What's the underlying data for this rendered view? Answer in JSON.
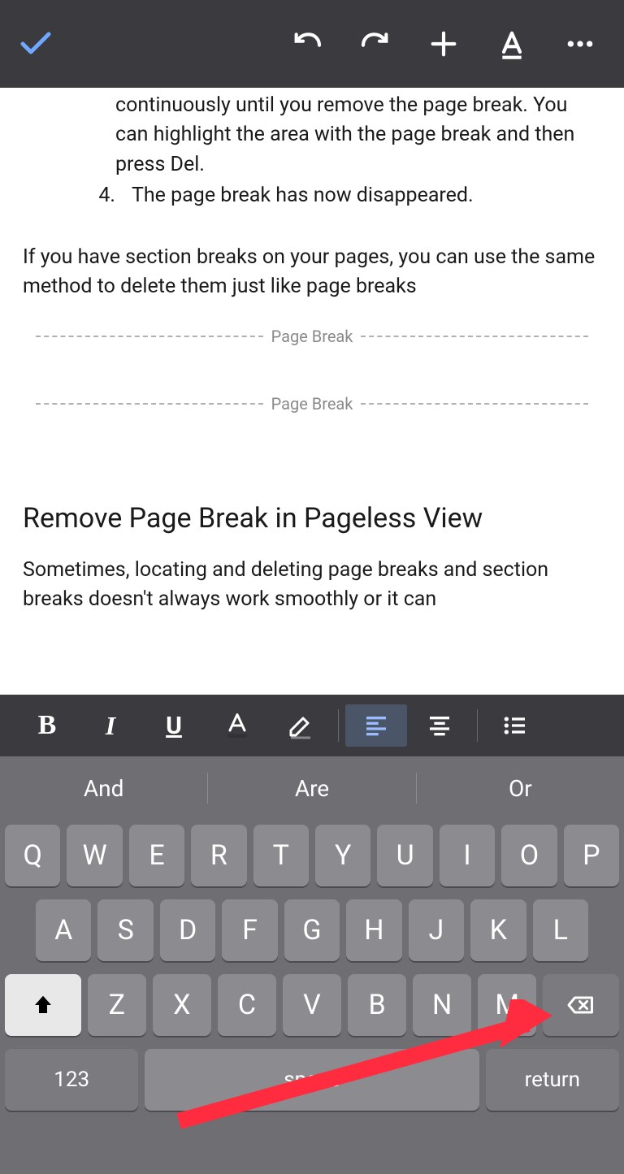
{
  "document": {
    "partial_step3": "continuously until you remove the page break. You can highlight the area with the page break and then press Del.",
    "step4_num": "4.",
    "step4_text": "The page break has now disappeared.",
    "body_para": "If you have section breaks on your pages, you can use the same method to delete them just like page breaks",
    "page_break_label": "Page Break",
    "heading": "Remove Page Break in Pageless View",
    "body2": "Sometimes, locating and deleting page breaks and section breaks doesn't always work smoothly or it can"
  },
  "format_toolbar": {
    "bold": "B",
    "italic": "I",
    "underline": "U"
  },
  "keyboard": {
    "suggestions": [
      "And",
      "Are",
      "Or"
    ],
    "row1": [
      "Q",
      "W",
      "E",
      "R",
      "T",
      "Y",
      "U",
      "I",
      "O",
      "P"
    ],
    "row2": [
      "A",
      "S",
      "D",
      "F",
      "G",
      "H",
      "J",
      "K",
      "L"
    ],
    "row3": [
      "Z",
      "X",
      "C",
      "V",
      "B",
      "N",
      "M"
    ],
    "num_key": "123",
    "space_key": "space",
    "return_key": "return"
  }
}
